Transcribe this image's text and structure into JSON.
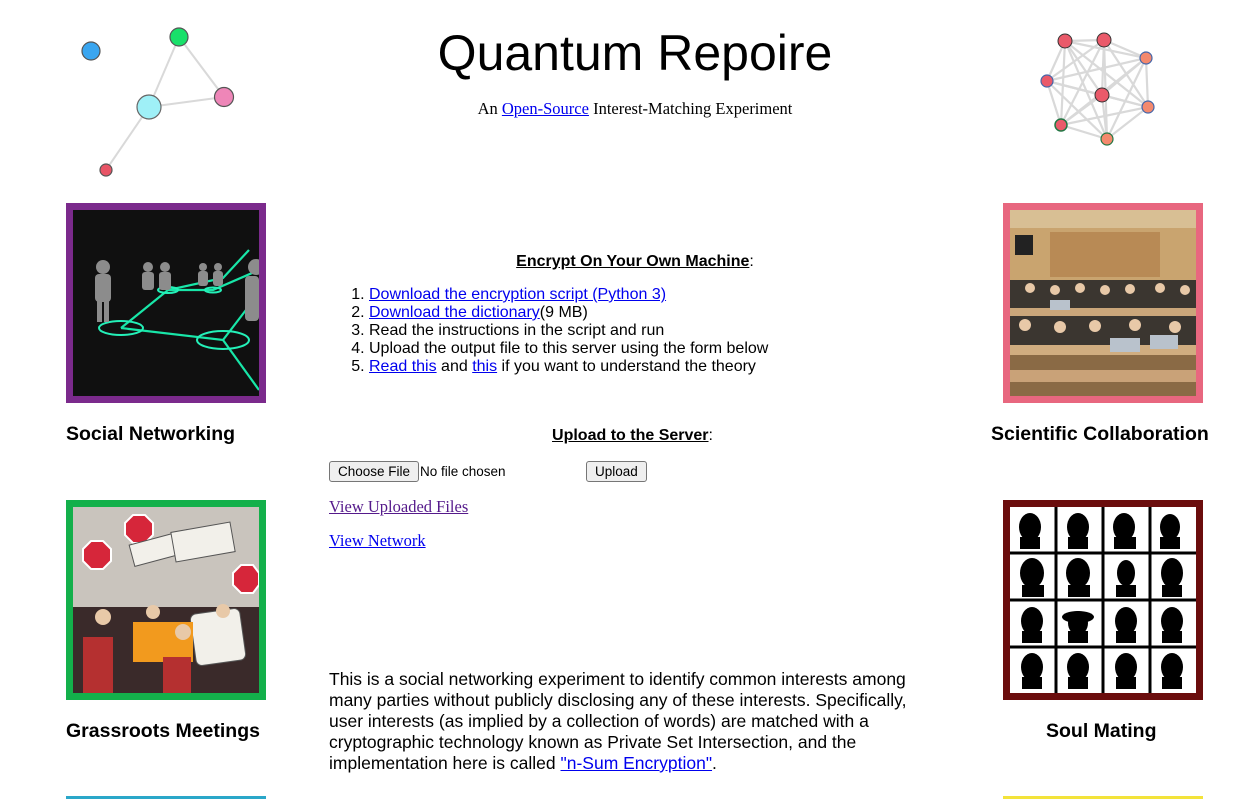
{
  "header": {
    "title": "Quantum Repoire",
    "subtitle_prefix": "An ",
    "subtitle_link": "Open-Source",
    "subtitle_suffix": " Interest-Matching Experiment"
  },
  "tiles": {
    "social_networking": "Social Networking",
    "scientific_collaboration": "Scientific Collaboration",
    "grassroots_meetings": "Grassroots Meetings",
    "soul_mating": "Soul Mating"
  },
  "encrypt": {
    "heading": "Encrypt On Your Own Machine",
    "heading_colon": ":",
    "step1_link": "Download the encryption script (Python 3)",
    "step2_link": "Download the dictionary",
    "step2_suffix": "(9 MB)",
    "step3": "Read the instructions in the script and run",
    "step4": "Upload the output file to this server using the form below",
    "step5_link1": "Read this",
    "step5_and": " and ",
    "step5_link2": "this",
    "step5_suffix": " if you want to understand the theory"
  },
  "upload": {
    "heading": "Upload to the Server",
    "heading_colon": ":",
    "choose_file_label": "Choose File",
    "no_file_text": "No file chosen",
    "upload_button": "Upload"
  },
  "links": {
    "view_uploaded": "View Uploaded Files",
    "view_network": "View Network"
  },
  "description": {
    "text": "This is a social networking experiment to identify common interests among many parties without publicly disclosing any of these interests. Specifically, user interests (as implied by a collection of words) are matched with a cryptographic technology known as Private Set Intersection, and the implementation here is called ",
    "link": "\"n-Sum Encryption\"",
    "end": "."
  },
  "colors": {
    "social_frame": "#7b2a8c",
    "science_frame": "#e8677f",
    "grassroots_frame": "#13b04b",
    "soul_frame": "#6b0d0d",
    "link": "#0000ee",
    "visited_link": "#551a8b"
  }
}
